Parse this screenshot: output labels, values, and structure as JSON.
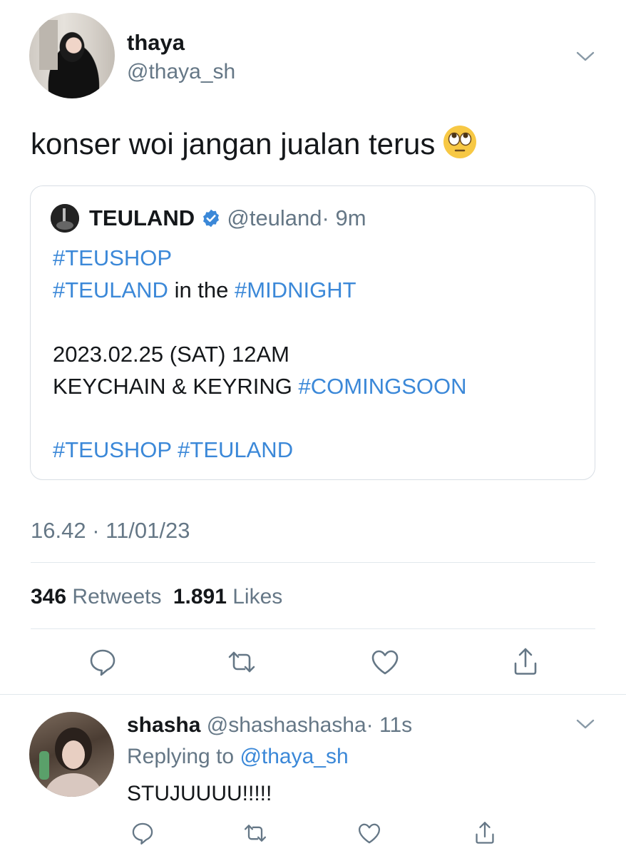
{
  "tweet": {
    "display_name": "thaya",
    "handle": "@thaya_sh",
    "text": "konser woi jangan jualan terus",
    "emoji": "face-with-rolling-eyes",
    "timestamp": "16.42 · 11/01/23",
    "retweets_count": "346",
    "retweets_label": "Retweets",
    "likes_count": "1.891",
    "likes_label": "Likes"
  },
  "quoted": {
    "display_name": "TEULAND",
    "handle": "@teuland",
    "time": "· 9m",
    "line1": "#TEUSHOP",
    "line2_tag1": "#TEULAND",
    "line2_mid": "in the",
    "line2_tag2": "#MIDNIGHT",
    "line3": "2023.02.25 (SAT) 12AM",
    "line4_text": "KEYCHAIN & KEYRING",
    "line4_tag": "#COMINGSOON",
    "line5": "#TEUSHOP #TEULAND"
  },
  "reply": {
    "display_name": "shasha",
    "handle": "@shashashasha",
    "time": "· 11s",
    "replying_prefix": "Replying to",
    "replying_handle": "@thaya_sh",
    "text": "STUJUUUU!!!!!"
  },
  "colors": {
    "accent": "#3b88d8",
    "secondary_text": "#657786",
    "divider": "#e1e8ed"
  },
  "icons": [
    "reply-icon",
    "retweet-icon",
    "like-icon",
    "share-icon",
    "chevron-down-icon",
    "verified-badge-icon"
  ]
}
